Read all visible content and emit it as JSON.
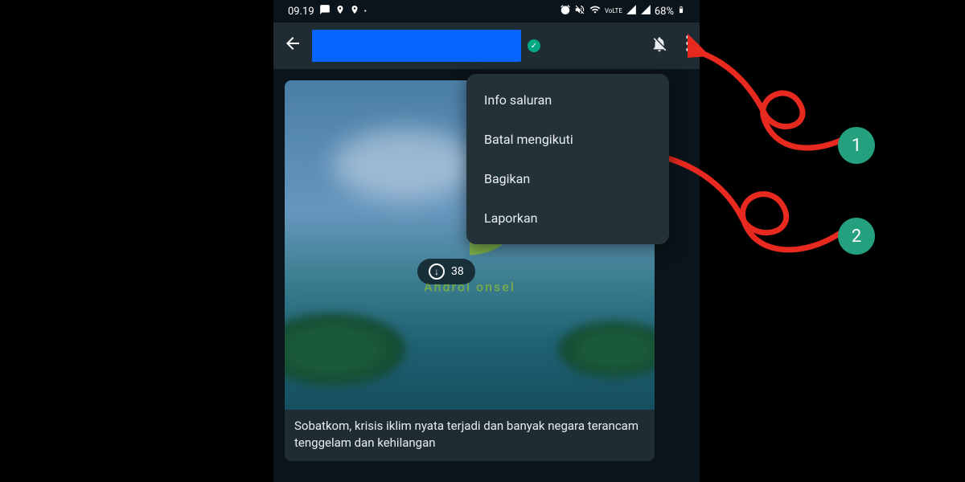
{
  "status_bar": {
    "time": "09.19",
    "battery": "68%",
    "network_label": "VoLTE"
  },
  "header": {
    "verified": "✓"
  },
  "menu": {
    "items": [
      {
        "label": "Info saluran"
      },
      {
        "label": "Batal mengikuti"
      },
      {
        "label": "Bagikan"
      },
      {
        "label": "Laporkan"
      }
    ]
  },
  "message": {
    "download_count": "38",
    "text": "Sobatkom, krisis iklim nyata terjadi dan banyak negara terancam tenggelam dan kehilangan",
    "watermark": "Androi   onsel"
  },
  "annotations": {
    "step1": "1",
    "step2": "2"
  }
}
